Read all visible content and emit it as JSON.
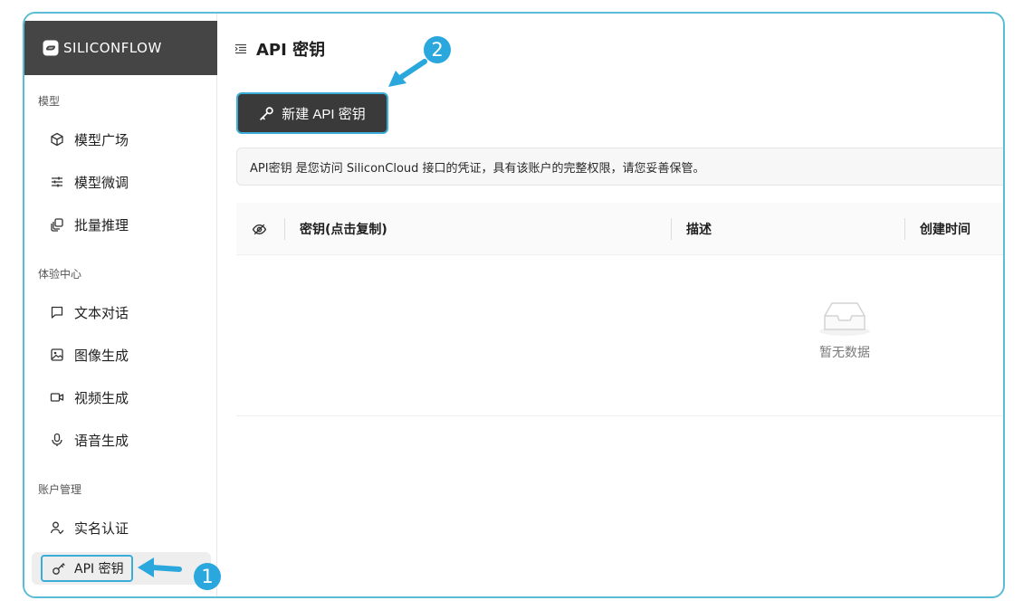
{
  "brand": {
    "name": "SILICONFLOW",
    "logo_icon": "siliconflow-logo-icon"
  },
  "sidebar": {
    "sections": [
      {
        "title": "模型",
        "items": [
          {
            "label": "模型广场",
            "icon": "cube-icon"
          },
          {
            "label": "模型微调",
            "icon": "sliders-icon"
          },
          {
            "label": "批量推理",
            "icon": "layers-icon"
          }
        ]
      },
      {
        "title": "体验中心",
        "items": [
          {
            "label": "文本对话",
            "icon": "chat-bubble-icon"
          },
          {
            "label": "图像生成",
            "icon": "image-icon"
          },
          {
            "label": "视频生成",
            "icon": "video-camera-icon"
          },
          {
            "label": "语音生成",
            "icon": "microphone-icon"
          }
        ]
      },
      {
        "title": "账户管理",
        "items": [
          {
            "label": "实名认证",
            "icon": "user-check-icon"
          },
          {
            "label": "API 密钥",
            "icon": "key-icon",
            "active": true
          }
        ]
      }
    ]
  },
  "main": {
    "title": "API 密钥",
    "new_key_button": "新建 API 密钥",
    "notice": "API密钥 是您访问 SiliconCloud 接口的凭证，具有该账户的完整权限，请您妥善保管。",
    "table": {
      "columns": [
        "密钥(点击复制)",
        "描述",
        "创建时间"
      ],
      "empty_text": "暂无数据"
    }
  },
  "annotations": {
    "badge_1": "1",
    "badge_2": "2",
    "accent": "#2aa7dc"
  }
}
